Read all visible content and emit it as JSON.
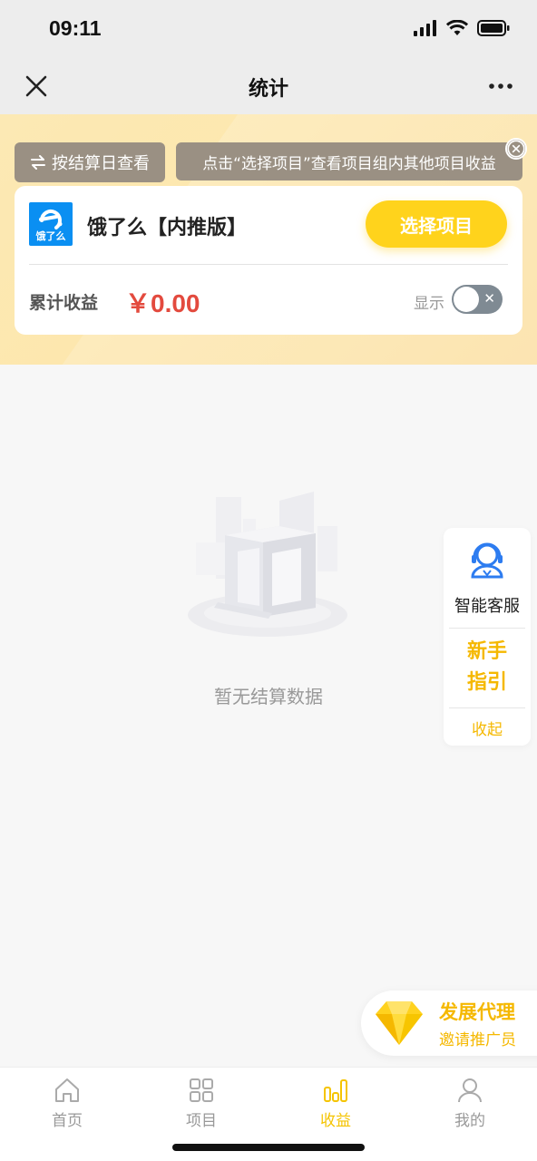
{
  "status_bar": {
    "time": "09:11"
  },
  "nav": {
    "title": "统计"
  },
  "header": {
    "settle_button": "按结算日查看",
    "tip": "点击“选择项目”查看项目组内其他项目收益"
  },
  "card": {
    "logo_text": "饿了么",
    "project_name": "饿了么【内推版】",
    "select_button": "选择项目",
    "total_label": "累计收益",
    "total_value": "￥0.00",
    "show_label": "显示",
    "show_toggle_on": false
  },
  "empty": {
    "text": "暂无结算数据"
  },
  "side_panel": {
    "customer_service": "智能客服",
    "guide_line1": "新手",
    "guide_line2": "指引",
    "collapse": "收起"
  },
  "agent_banner": {
    "title": "发展代理",
    "subtitle": "邀请推广员"
  },
  "tabbar": {
    "tabs": [
      {
        "label": "首页",
        "icon": "home-icon",
        "active": false
      },
      {
        "label": "项目",
        "icon": "grid-icon",
        "active": false
      },
      {
        "label": "收益",
        "icon": "bar-chart-icon",
        "active": true
      },
      {
        "label": "我的",
        "icon": "user-icon",
        "active": false
      }
    ]
  },
  "colors": {
    "accent": "#ffd31c",
    "amount_red": "#e34a3e",
    "header_bg": "#fde7ae",
    "tag_bg": "#9a9083",
    "tab_active": "#f5c400",
    "logo_blue": "#0a8ff2"
  }
}
